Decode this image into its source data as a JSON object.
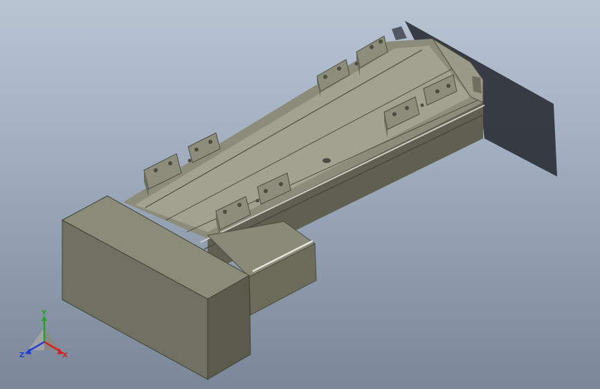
{
  "window": {
    "background_top": "#b9c4d3",
    "background_bottom": "#7a8798"
  },
  "model": {
    "part_color": "#8a8a78",
    "shadow_color": "#2d3138"
  },
  "triad": {
    "x_label": "X",
    "y_label": "Y",
    "z_label": "Z",
    "x_color": "#d62020",
    "y_color": "#1fa51f",
    "z_color": "#1f3fd6"
  }
}
